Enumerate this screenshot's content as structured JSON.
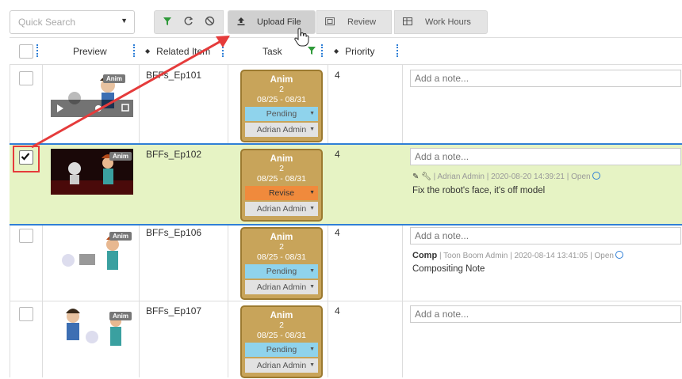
{
  "toolbar": {
    "quick_search_placeholder": "Quick Search",
    "upload_label": "Upload File",
    "review_label": "Review",
    "work_hours_label": "Work Hours"
  },
  "columns": {
    "preview": "Preview",
    "related_item": "Related Item",
    "task": "Task",
    "priority": "Priority"
  },
  "rows": [
    {
      "item": "BFFs_Ep101",
      "task": "Anim",
      "task_num": "2",
      "dates": "08/25 - 08/31",
      "status": "Pending",
      "assignee": "Adrian Admin",
      "priority": "4",
      "note_placeholder": "Add a note...",
      "badge": "Anim"
    },
    {
      "item": "BFFs_Ep102",
      "task": "Anim",
      "task_num": "2",
      "dates": "08/25 - 08/31",
      "status": "Revise",
      "assignee": "Adrian Admin",
      "priority": "4",
      "note_placeholder": "Add a note...",
      "note_author": "Adrian Admin",
      "note_time": "2020-08-20 14:39:21",
      "note_state": "Open",
      "note_text": "Fix the robot's face, it's off model",
      "badge": "Anim"
    },
    {
      "item": "BFFs_Ep106",
      "task": "Anim",
      "task_num": "2",
      "dates": "08/25 - 08/31",
      "status": "Pending",
      "assignee": "Adrian Admin",
      "priority": "4",
      "note_placeholder": "Add a note...",
      "note_tag": "Comp",
      "note_author": "Toon Boom Admin",
      "note_time": "2020-08-14 13:41:05",
      "note_state": "Open",
      "note_text": "Compositing Note",
      "badge": "Anim"
    },
    {
      "item": "BFFs_Ep107",
      "task": "Anim",
      "task_num": "2",
      "dates": "08/25 - 08/31",
      "status": "Pending",
      "assignee": "Adrian Admin",
      "priority": "4",
      "note_placeholder": "Add a note...",
      "badge": "Anim"
    }
  ],
  "colors": {
    "selected_row": "#e6f3c4",
    "selection_blue": "#2f7fd6",
    "task_gold": "#c8a45a",
    "pending": "#8fd3ec",
    "revise": "#f08a3c",
    "annotation_red": "#e53b3b"
  }
}
